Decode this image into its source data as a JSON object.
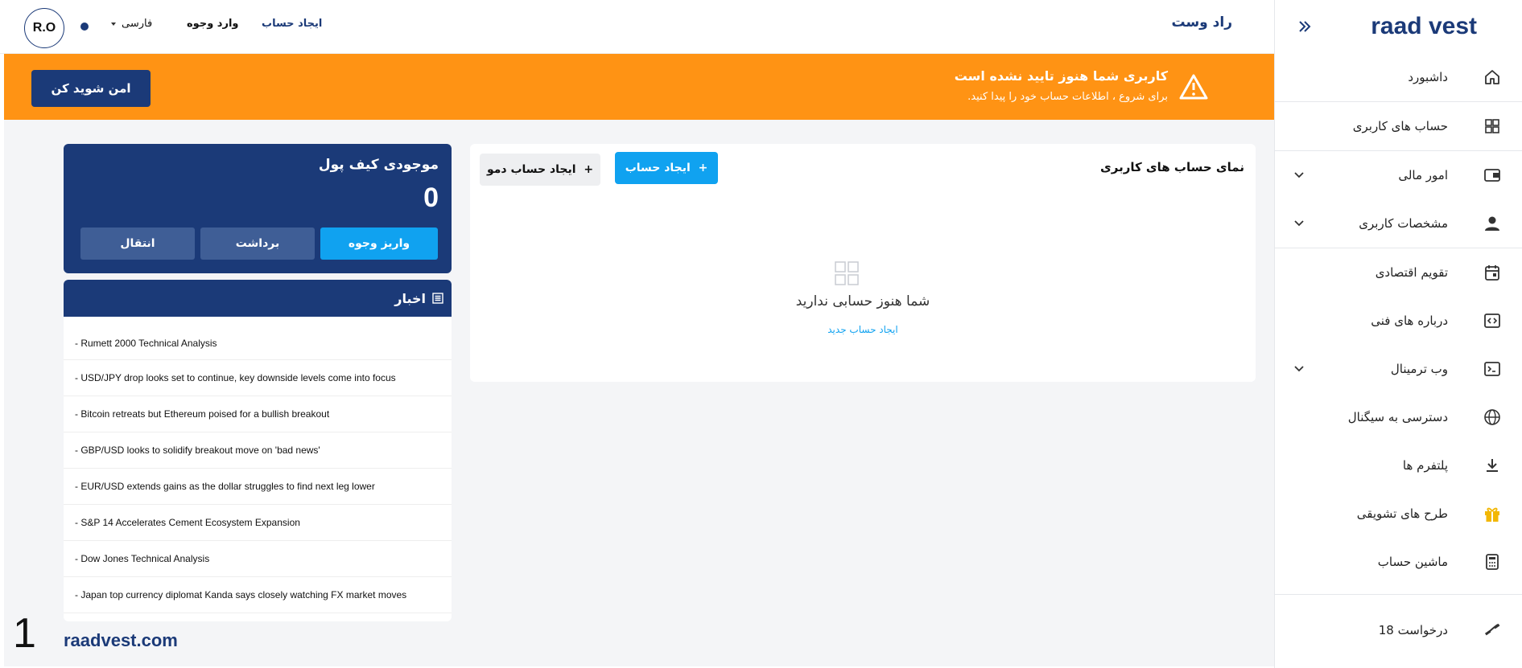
{
  "sidebar": {
    "logo": "raad vest",
    "items": [
      {
        "label": "داشبورد",
        "icon": "home-icon"
      },
      {
        "label": "حساب های کاربری",
        "icon": "grid-icon"
      },
      {
        "label": "امور مالی",
        "icon": "wallet-icon"
      },
      {
        "label": "مشخصات کاربری",
        "icon": "user-icon"
      },
      {
        "label": "تقویم اقتصادی",
        "icon": "calendar-icon"
      },
      {
        "label": "درباره های فنی",
        "icon": "code-icon"
      },
      {
        "label": "وب ترمینال",
        "icon": "terminal-icon"
      },
      {
        "label": "دسترسی به سیگنال",
        "icon": "globe-icon"
      },
      {
        "label": "پلتفرم ها",
        "icon": "download-icon"
      },
      {
        "label": "طرح های تشویقی",
        "icon": "gift-icon"
      },
      {
        "label": "ماشین حساب",
        "icon": "calculator-icon"
      },
      {
        "label": "درخواست 18",
        "icon": "satellite-icon"
      }
    ]
  },
  "topbar": {
    "brand": "راد وست",
    "signup": "ایجاد حساب",
    "login": "وارد وجوه",
    "language": "فارسی",
    "avatar": "R.O"
  },
  "banner": {
    "title": "کاربری شما هنوز تایید نشده است",
    "subtitle": "برای شروع ، اطلاعات حساب خود را پیدا کنید.",
    "button": "امن شوید کن"
  },
  "accounts": {
    "title": "نمای حساب های کاربری",
    "create_button": "ایجاد حساب",
    "demo_button": "ایجاد حساب دمو",
    "empty_text": "شما هنوز حسابی ندارید",
    "empty_link": "ایجاد حساب جدید"
  },
  "wallet": {
    "title": "موجودی کیف پول",
    "balance": "0",
    "deposit": "واریز وجوه",
    "withdraw": "برداشت",
    "transfer": "انتقال"
  },
  "news": {
    "title": "اخبار",
    "items": [
      "- Rumett 2000 Technical Analysis",
      "- USD/JPY drop looks set to continue, key downside levels come into focus",
      "- Bitcoin retreats but Ethereum poised for a bullish breakout",
      "- GBP/USD looks to solidify breakout move on 'bad news'",
      "- EUR/USD extends gains as the dollar struggles to find next leg lower",
      "- S&P 14 Accelerates Cement Ecosystem Expansion",
      "- Dow Jones Technical Analysis",
      "- Japan top currency diplomat Kanda says closely watching FX market moves"
    ]
  },
  "footer": {
    "number": "1",
    "site": "raadvest.com"
  },
  "colors": {
    "primary": "#1b3a78",
    "accent": "#10a2f0",
    "warning": "#ff9314"
  }
}
